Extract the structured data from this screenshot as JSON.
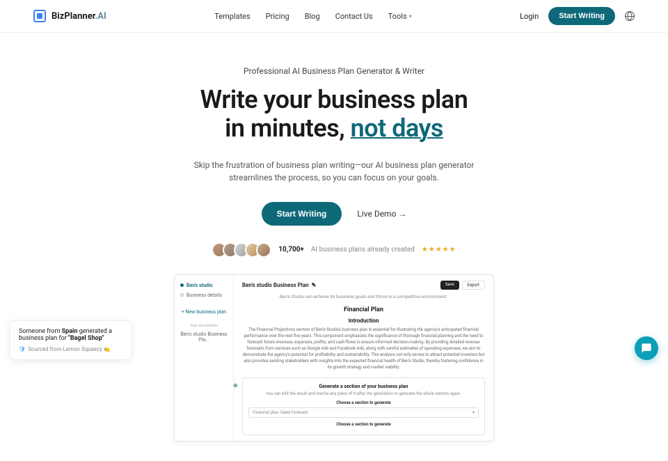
{
  "brand": {
    "name": "BizPlanner",
    "suffix": ".AI"
  },
  "nav": {
    "templates": "Templates",
    "pricing": "Pricing",
    "blog": "Blog",
    "contact": "Contact Us",
    "tools": "Tools"
  },
  "header": {
    "login": "Login",
    "start": "Start Writing"
  },
  "hero": {
    "eyebrow": "Professional AI Business Plan Generator & Writer",
    "line1": "Write your business plan",
    "line2a": "in minutes, ",
    "line2b": "not days",
    "sub": "Skip the frustration of business plan writing—our AI business plan generator streamlines the process, so you can focus on your goals.",
    "cta": "Start Writing",
    "demo": "Live Demo →"
  },
  "social": {
    "count": "10,700+",
    "text": " AI business plans already created",
    "stars": "★★★★★"
  },
  "mock": {
    "side": {
      "studio": "Ben's studio",
      "details": "Business details",
      "new": "+ New business plan",
      "your_docs": "Your documents",
      "doc": "Ben's studio Business Pla..."
    },
    "main": {
      "title": "Ben's studio Business Plan",
      "save": "Save",
      "export": "Export",
      "tagline": "Ben's Studio can achieve its business goals and thrive in a competitive environment.",
      "h1": "Financial Plan",
      "h2": "Introduction",
      "para": "The Financial Projections section of Ben's Studio's business plan is essential for illustrating the agency's anticipated financial performance over the next five years. This component emphasizes the significance of thorough financial planning and the need to forecast future revenues, expenses, profits, and cash flows to ensure informed decision-making. By providing detailed revenue forecasts from services such as Google Ads and Facebook Ads, along with careful estimates of operating expenses, we aim to demonstrate the agency's potential for profitability and sustainability. This analysis not only serves to attract potential investors but also provides existing stakeholders with insights into the expected financial health of Ben's Studio, thereby fostering confidence in its growth strategy and market viability.",
      "gen_title": "Generate a section of your business plan",
      "gen_sub": "You can edit the result and rewrite any piece of it after the generation or generate the whole section again.",
      "gen_label": "Choose a section to generate",
      "gen_select": "Financial plan: Sales Forecast",
      "gen_label2": "Choose a section to generate"
    }
  },
  "toast": {
    "prefix": "Someone from ",
    "country": "Spain",
    "mid": " generated a business plan for ",
    "shop": "\"Bagel Shop\"",
    "source": "Sourced from Lemon Squeezy"
  }
}
